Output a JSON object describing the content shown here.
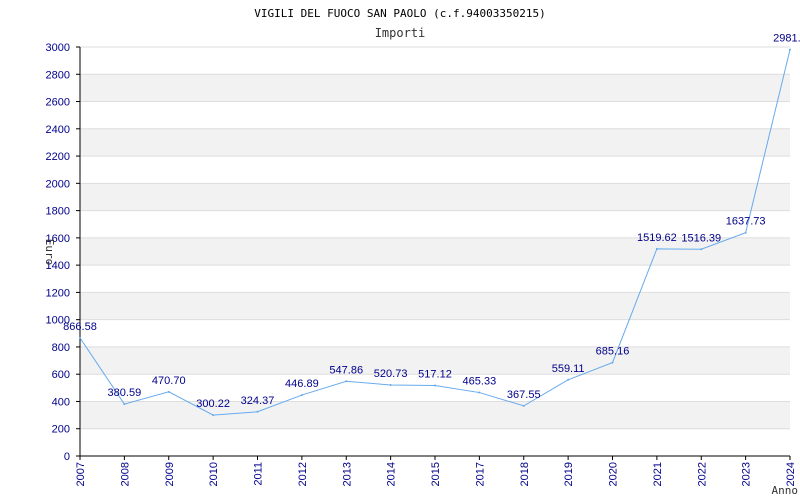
{
  "chart_data": {
    "type": "line",
    "title": "VIGILI DEL FUOCO SAN PAOLO (c.f.94003350215)",
    "subtitle": "Importi",
    "ylabel": "Euro",
    "xlabel": "Anno",
    "ylim": [
      0,
      3000
    ],
    "y_ticks": [
      "0",
      "200",
      "400",
      "600",
      "800",
      "1000",
      "1200",
      "1400",
      "1600",
      "1800",
      "2000",
      "2200",
      "2400",
      "2600",
      "2800",
      "3000"
    ],
    "categories": [
      "2007",
      "2008",
      "2009",
      "2010",
      "2011",
      "2012",
      "2013",
      "2014",
      "2015",
      "2017",
      "2018",
      "2019",
      "2020",
      "2021",
      "2022",
      "2023",
      "2024"
    ],
    "values": [
      866.58,
      380.59,
      470.7,
      300.22,
      324.37,
      446.89,
      547.86,
      520.73,
      517.12,
      465.33,
      367.55,
      559.11,
      685.16,
      1519.62,
      1516.39,
      1637.73,
      2981.0
    ],
    "data_labels": [
      "866.58",
      "380.59",
      "470.70",
      "300.22",
      "324.37",
      "446.89",
      "547.86",
      "520.73",
      "517.12",
      "465.33",
      "367.55",
      "559.11",
      "685.16",
      "1519.62",
      "1516.39",
      "1637.73",
      "2981.0"
    ],
    "grid": true,
    "colors": {
      "line": "#66aaee",
      "band": "#f2f2f2",
      "grid": "#dddddd",
      "text": "#00008b"
    }
  }
}
